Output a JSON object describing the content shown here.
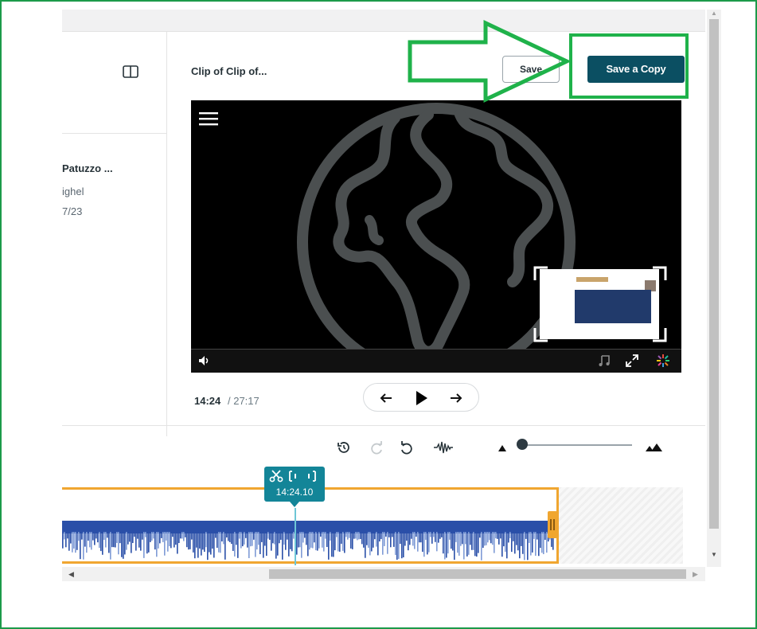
{
  "media": {
    "title": "Patuzzo ...",
    "owner": "ighel",
    "date": "7/23"
  },
  "editor": {
    "clip_title": "Clip of Clip of...",
    "save_label": "Save",
    "save_copy_label": "Save a Copy"
  },
  "player": {
    "current_time": "14:24",
    "duration": " / 27:17"
  },
  "timeline": {
    "playhead_time": "14:24.10"
  },
  "colors": {
    "accent": "#0b4f62",
    "playhead": "#138598",
    "clip": "#f0a630",
    "waveform": "#2a4fa8",
    "annotation": "#1fb24a"
  },
  "icons": [
    "panel-toggle-icon",
    "menu-icon",
    "globe-icon",
    "volume-icon",
    "music-icon",
    "expand-icon",
    "loading-icon",
    "arrow-left-icon",
    "play-icon",
    "arrow-right-icon",
    "history-icon",
    "redo-icon",
    "undo-icon",
    "waveform-icon",
    "zoom-out-icon",
    "zoom-in-icon",
    "cut-icon",
    "split-left-icon",
    "split-right-icon"
  ]
}
